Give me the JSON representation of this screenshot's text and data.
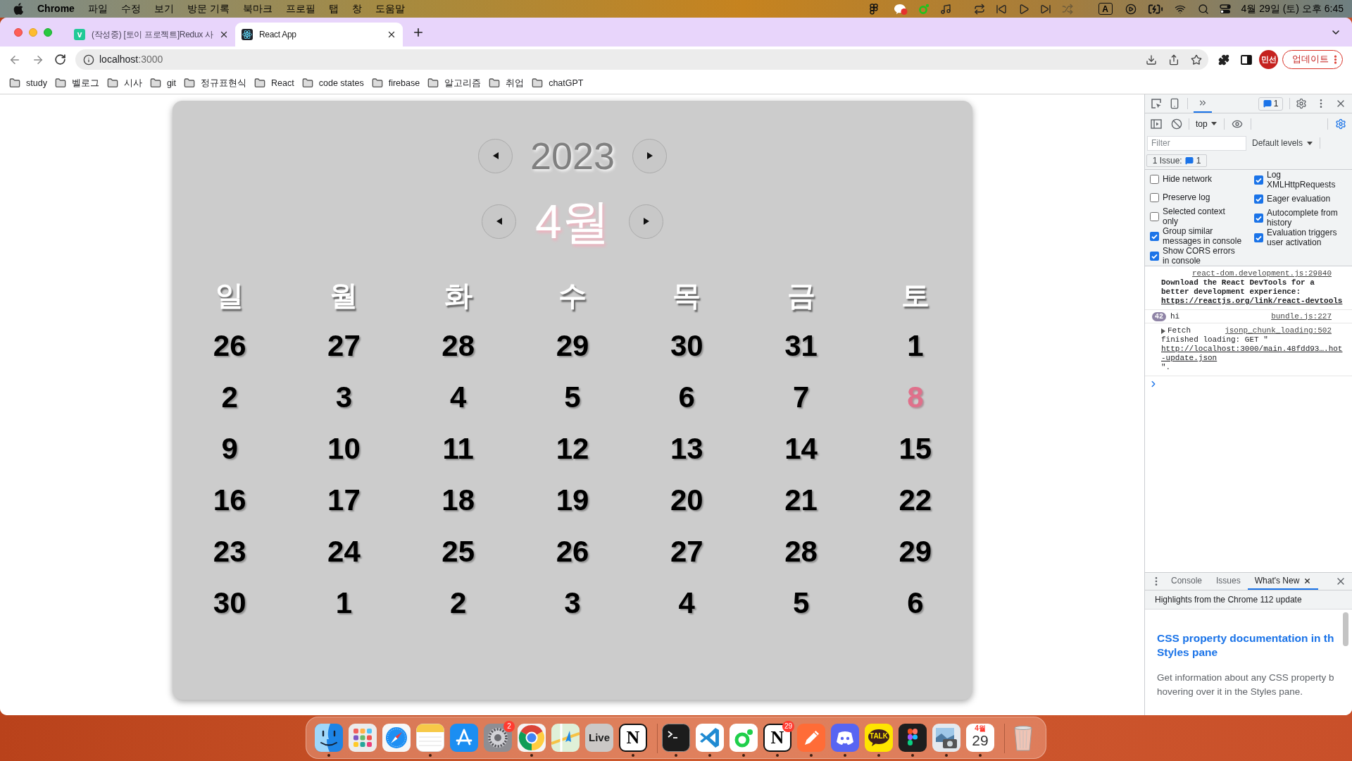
{
  "menu_bar": {
    "app_name": "Chrome",
    "menus": [
      "파일",
      "수정",
      "보기",
      "방문 기록",
      "북마크",
      "프로필",
      "탭",
      "창",
      "도움말"
    ],
    "input_source": "A",
    "clock": "4월 29일 (토) 오후 6:45"
  },
  "browser": {
    "tabs": [
      {
        "title": "(작성중) [토이 프로젝트]Redux 사",
        "favicon": {
          "kind": "letter",
          "text": "v"
        },
        "selected": false
      },
      {
        "title": "React App",
        "favicon": {
          "kind": "atom"
        },
        "selected": true
      }
    ],
    "address": {
      "host": "localhost",
      "port": ":3000"
    },
    "profile": "민선",
    "update_button": "업데이트",
    "bookmarks": [
      "study",
      "벨로그",
      "시사",
      "git",
      "정규표현식",
      "React",
      "code states",
      "firebase",
      "알고리즘",
      "취업",
      "chatGPT"
    ]
  },
  "calendar": {
    "year": "2023",
    "month": "4월",
    "weekdays": [
      "일",
      "월",
      "화",
      "수",
      "목",
      "금",
      "토"
    ],
    "weeks": [
      [
        {
          "label": "26",
          "highlighted": false
        },
        {
          "label": "27",
          "highlighted": false
        },
        {
          "label": "28",
          "highlighted": false
        },
        {
          "label": "29",
          "highlighted": false
        },
        {
          "label": "30",
          "highlighted": false
        },
        {
          "label": "31",
          "highlighted": false
        },
        {
          "label": "1",
          "highlighted": false
        }
      ],
      [
        {
          "label": "2",
          "highlighted": false
        },
        {
          "label": "3",
          "highlighted": false
        },
        {
          "label": "4",
          "highlighted": false
        },
        {
          "label": "5",
          "highlighted": false
        },
        {
          "label": "6",
          "highlighted": false
        },
        {
          "label": "7",
          "highlighted": false
        },
        {
          "label": "8",
          "highlighted": true
        }
      ],
      [
        {
          "label": "9",
          "highlighted": false
        },
        {
          "label": "10",
          "highlighted": false
        },
        {
          "label": "11",
          "highlighted": false
        },
        {
          "label": "12",
          "highlighted": false
        },
        {
          "label": "13",
          "highlighted": false
        },
        {
          "label": "14",
          "highlighted": false
        },
        {
          "label": "15",
          "highlighted": false
        }
      ],
      [
        {
          "label": "16",
          "highlighted": false
        },
        {
          "label": "17",
          "highlighted": false
        },
        {
          "label": "18",
          "highlighted": false
        },
        {
          "label": "19",
          "highlighted": false
        },
        {
          "label": "20",
          "highlighted": false
        },
        {
          "label": "21",
          "highlighted": false
        },
        {
          "label": "22",
          "highlighted": false
        }
      ],
      [
        {
          "label": "23",
          "highlighted": false
        },
        {
          "label": "24",
          "highlighted": false
        },
        {
          "label": "25",
          "highlighted": false
        },
        {
          "label": "26",
          "highlighted": false
        },
        {
          "label": "27",
          "highlighted": false
        },
        {
          "label": "28",
          "highlighted": false
        },
        {
          "label": "29",
          "highlighted": false
        }
      ],
      [
        {
          "label": "30",
          "highlighted": false
        },
        {
          "label": "1",
          "highlighted": false
        },
        {
          "label": "2",
          "highlighted": false
        },
        {
          "label": "3",
          "highlighted": false
        },
        {
          "label": "4",
          "highlighted": false
        },
        {
          "label": "5",
          "highlighted": false
        },
        {
          "label": "6",
          "highlighted": false
        }
      ]
    ]
  },
  "devtools": {
    "toolbar": {
      "issues_count": "1"
    },
    "console_toolbar": {
      "context": "top",
      "filter_placeholder": "Filter",
      "levels": "Default levels",
      "issues_label": "1 Issue:",
      "issues_count": "1"
    },
    "settings_left": [
      {
        "label": "Hide network",
        "checked": false
      },
      {
        "label": "Preserve log",
        "checked": false
      },
      {
        "label": "Selected context only",
        "checked": false
      },
      {
        "label": "Group similar messages in console",
        "checked": true
      },
      {
        "label": "Show CORS errors in console",
        "checked": true
      }
    ],
    "settings_right": [
      {
        "label": "Log XMLHttpRequests",
        "checked": true
      },
      {
        "label": "Eager evaluation",
        "checked": true
      },
      {
        "label": "Autocomplete from history",
        "checked": true
      },
      {
        "label": "Evaluation triggers user activation",
        "checked": true
      }
    ],
    "messages": [
      {
        "kind": "info",
        "source": "react-dom.development.js:29840",
        "text": "Download the React DevTools for a better development experience:",
        "link": "https://reactjs.org/link/react-devtools"
      },
      {
        "kind": "log",
        "count": "42",
        "text": "hi",
        "source": "bundle.js:227"
      },
      {
        "kind": "fetch",
        "expanded": false,
        "text": "Fetch",
        "source": "jsonp_chunk_loading:502",
        "detail": "finished loading: GET \"",
        "link": "http://localhost:3000/main.48fdd93….hot-update.json",
        "tail": "\"."
      }
    ],
    "drawer": {
      "tabs": [
        {
          "label": "Console",
          "selected": false,
          "closable": false
        },
        {
          "label": "Issues",
          "selected": false,
          "closable": false
        },
        {
          "label": "What's New",
          "selected": true,
          "closable": true
        }
      ],
      "banner": "Highlights from the Chrome 112 update",
      "heading_lines": [
        "CSS property documentation in th",
        "Styles pane"
      ],
      "body_lines": [
        "Get information about any CSS property b",
        "hovering over it in the Styles pane."
      ]
    }
  },
  "dock": [
    {
      "kind": "finder",
      "running": true
    },
    {
      "kind": "launchpad",
      "running": false
    },
    {
      "kind": "safari",
      "running": false
    },
    {
      "kind": "notes",
      "running": true
    },
    {
      "kind": "appstore",
      "running": false
    },
    {
      "kind": "settings",
      "running": false,
      "badge": "2"
    },
    {
      "kind": "chrome",
      "running": true
    },
    {
      "kind": "maps",
      "running": false
    },
    {
      "kind": "live",
      "running": false,
      "text": "Live"
    },
    {
      "kind": "notion",
      "running": true,
      "text": "N"
    },
    {
      "kind": "divider"
    },
    {
      "kind": "terminal",
      "running": true
    },
    {
      "kind": "vscode",
      "running": true
    },
    {
      "kind": "ring",
      "running": true
    },
    {
      "kind": "notion",
      "running": true,
      "text": "N",
      "badge": "29"
    },
    {
      "kind": "postman",
      "running": true
    },
    {
      "kind": "discord",
      "running": true
    },
    {
      "kind": "kakaotalk",
      "running": true,
      "text": "TALK"
    },
    {
      "kind": "figma",
      "running": true
    },
    {
      "kind": "preview",
      "running": true
    },
    {
      "kind": "calendar",
      "running": true,
      "month": "4월",
      "day": "29"
    },
    {
      "kind": "divider"
    },
    {
      "kind": "trash",
      "running": false
    }
  ]
}
